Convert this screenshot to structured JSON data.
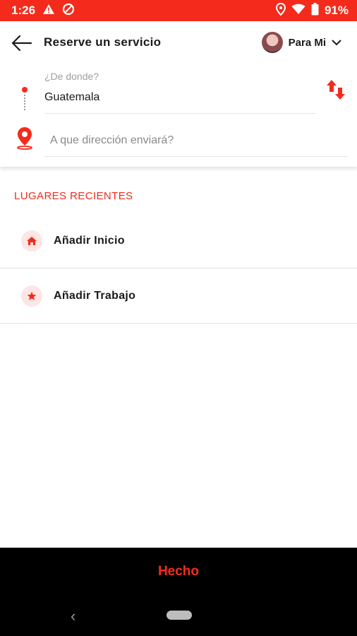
{
  "status_bar": {
    "time": "1:26",
    "battery": "91%"
  },
  "header": {
    "title": "Reserve un servicio",
    "profile_label": "Para Mi"
  },
  "route": {
    "from_label": "¿De donde?",
    "from_value": "Guatemala",
    "to_placeholder": "A que dirección enviará?"
  },
  "recent": {
    "section_title": "LUGARES RECIENTES",
    "items": [
      {
        "label": "Añadir Inicio",
        "icon": "home-icon"
      },
      {
        "label": "Añadir Trabajo",
        "icon": "star-icon"
      }
    ]
  },
  "footer": {
    "done_label": "Hecho"
  },
  "colors": {
    "accent": "#f42b1c",
    "footer_bg": "#000000"
  }
}
